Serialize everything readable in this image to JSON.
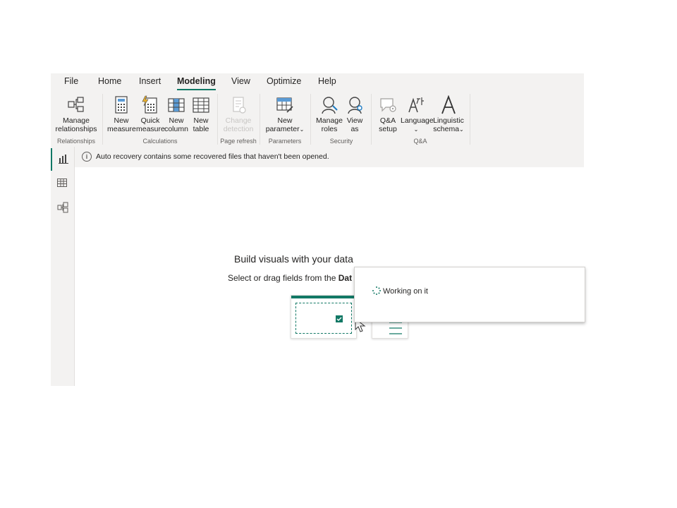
{
  "menu": {
    "tabs": [
      "File",
      "Home",
      "Insert",
      "Modeling",
      "View",
      "Optimize",
      "Help"
    ],
    "active": "Modeling"
  },
  "ribbon": {
    "manage_relationships": [
      "Manage",
      "relationships"
    ],
    "new_measure": [
      "New",
      "measure"
    ],
    "quick_measure": [
      "Quick",
      "measure"
    ],
    "new_column": [
      "New",
      "column"
    ],
    "new_table": [
      "New",
      "table"
    ],
    "change_detection": [
      "Change",
      "detection"
    ],
    "new_parameter": [
      "New",
      "parameter"
    ],
    "manage_roles": [
      "Manage",
      "roles"
    ],
    "view_as": [
      "View",
      "as"
    ],
    "qa_setup": [
      "Q&A",
      "setup"
    ],
    "language": "Language",
    "linguistic_schema": [
      "Linguistic",
      "schema"
    ],
    "groups": {
      "relationships": "Relationships",
      "calculations": "Calculations",
      "page_refresh": "Page refresh",
      "parameters": "Parameters",
      "security": "Security",
      "qa": "Q&A"
    }
  },
  "notice": {
    "text": "Auto recovery contains some recovered files that haven't been opened."
  },
  "canvas": {
    "title": "Build visuals with your data",
    "subtitle_prefix": "Select or drag fields from the ",
    "subtitle_bold": "Dat"
  },
  "popup": {
    "text": "Working on it"
  },
  "colors": {
    "accent": "#117865",
    "ribbon_bg": "#f3f2f1",
    "disabled": "#c8c6c4"
  }
}
